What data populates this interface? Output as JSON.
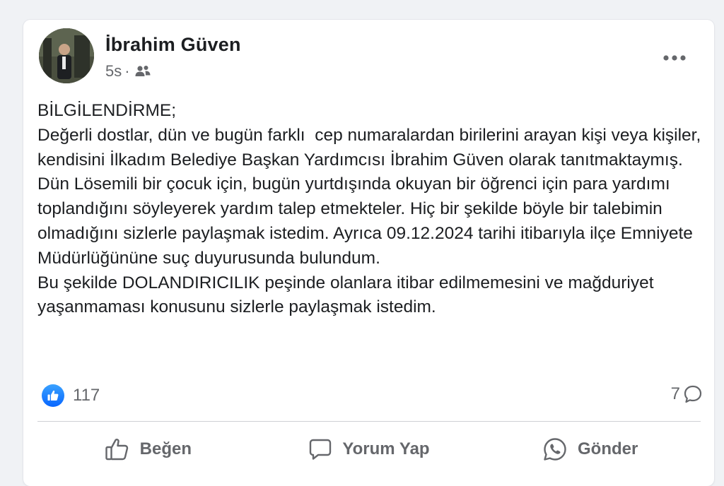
{
  "post": {
    "author": "İbrahim Güven",
    "time": "5s",
    "separator": "·",
    "audience_icon": "friends-icon",
    "more_icon": "more-options-icon",
    "body_lines": [
      "BİLGİLENDİRME;",
      "Değerli dostlar, dün ve bugün farklı  cep numaralardan birilerini arayan kişi veya kişiler, kendisini İlkadım Belediye Başkan Yardımcısı İbrahim Güven olarak tanıtmaktaymış. Dün Lösemili bir çocuk için, bugün yurtdışında okuyan bir öğrenci için para yardımı toplandığını söyleyerek yardım talep etmekteler. Hiç bir şekilde böyle bir talebimin olmadığını sizlerle paylaşmak istedim. Ayrıca 09.12.2024 tarihi itibarıyla ilçe Emniyete Müdürlüğününe suç duyurusunda bulundum.",
      "Bu şekilde DOLANDIRICILIK peşinde olanlara itibar edilmemesini ve mağduriyet yaşanmaması konusunu sizlerle paylaşmak istedim."
    ]
  },
  "stats": {
    "reaction_icon": "like-reaction-icon",
    "reaction_count": "117",
    "comment_count": "7",
    "comment_icon": "comment-icon"
  },
  "actions": {
    "like_label": "Beğen",
    "comment_label": "Yorum Yap",
    "send_label": "Gönder"
  },
  "colors": {
    "background": "#f0f2f5",
    "card": "#ffffff",
    "secondary_text": "#65676b",
    "like_blue": "#0866ff"
  }
}
